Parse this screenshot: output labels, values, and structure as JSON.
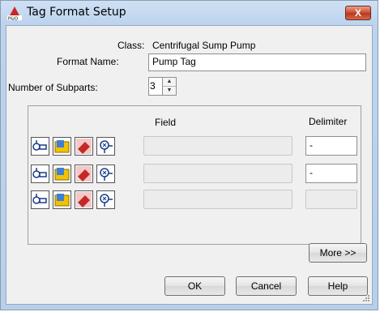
{
  "window": {
    "title": "Tag Format Setup",
    "close_label": "X"
  },
  "form": {
    "class_label": "Class:",
    "class_value": "Centrifugal Sump Pump",
    "format_name_label": "Format Name:",
    "format_name_value": "Pump Tag",
    "subparts_label": "Number of Subparts:",
    "subparts_value": "3"
  },
  "subparts": {
    "field_header": "Field",
    "delimiter_header": "Delimiter",
    "rows": [
      {
        "field": "",
        "delimiter": "-"
      },
      {
        "field": "",
        "delimiter": "-"
      },
      {
        "field": "",
        "delimiter": ""
      }
    ]
  },
  "buttons": {
    "more": "More >>",
    "ok": "OK",
    "cancel": "Cancel",
    "help": "Help"
  },
  "icons": [
    "select-property-icon",
    "folder-icon",
    "eraser-icon",
    "zoom-icon"
  ]
}
